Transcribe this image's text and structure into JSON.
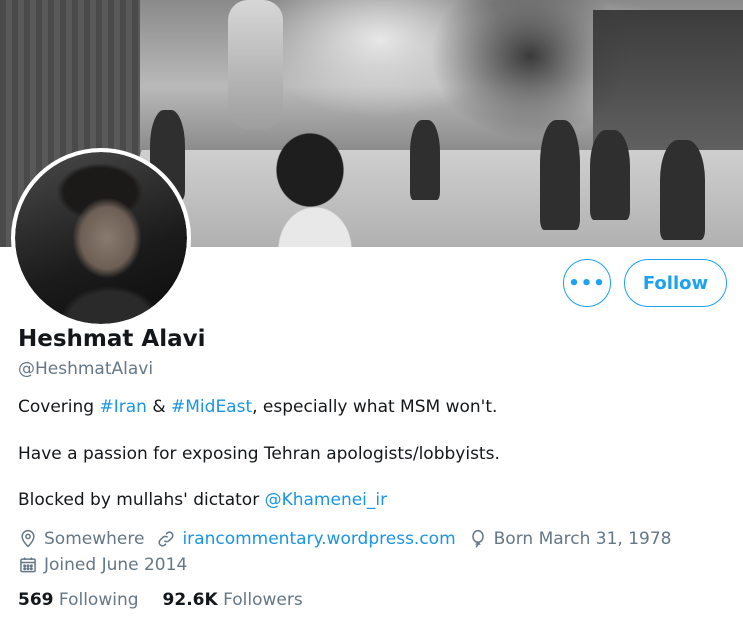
{
  "profile": {
    "name": "Heshmat Alavi",
    "handle": "@HeshmatAlavi",
    "bio": {
      "line1_prefix": "Covering ",
      "hashtag1": "#Iran",
      "line1_amp": " & ",
      "hashtag2": "#MidEast",
      "line1_suffix": ", especially what MSM won't.",
      "line2": "Have a passion for exposing Tehran apologists/lobbyists.",
      "line3_prefix": "Blocked by mullahs' dictator ",
      "mention": "@Khamenei_ir"
    },
    "location": "Somewhere",
    "website": "irancommentary.wordpress.com",
    "birthday": "Born March 31, 1978",
    "joined": "Joined June 2014"
  },
  "actions": {
    "more_label": "•••",
    "follow_label": "Follow"
  },
  "stats": {
    "following_count": "569",
    "following_label": "Following",
    "followers_count": "92.6K",
    "followers_label": "Followers"
  },
  "icons": {
    "location": "location-pin-icon",
    "link": "link-icon",
    "birthday": "balloon-icon",
    "joined": "calendar-icon"
  },
  "colors": {
    "accent": "#1da1f2",
    "link": "#1b95e0",
    "secondary_text": "#657786",
    "primary_text": "#14171a"
  }
}
